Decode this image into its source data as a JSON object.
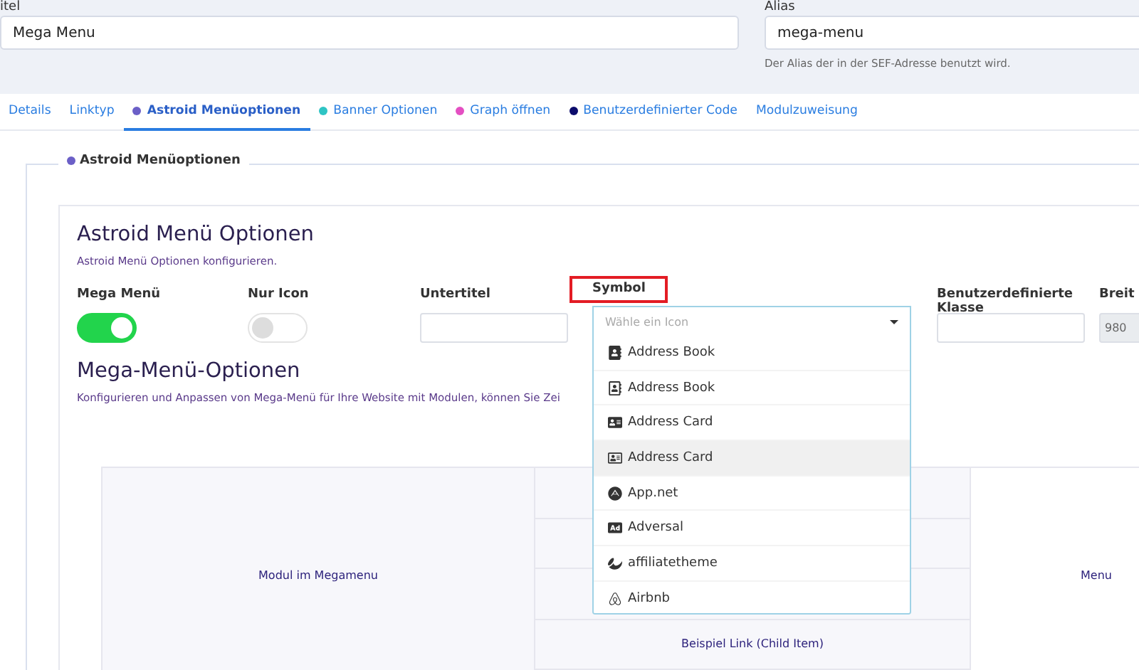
{
  "title_field": {
    "label": "itel",
    "value": "Mega Menu"
  },
  "alias_field": {
    "label": "Alias",
    "value": "mega-menu",
    "hint": "Der Alias der in der SEF-Adresse benutzt wird."
  },
  "tabs": [
    {
      "label": "Details",
      "selected": false
    },
    {
      "label": "Linktyp",
      "selected": false
    },
    {
      "label": "Astroid Menüoptionen",
      "selected": true,
      "color": "#6b5fc7"
    },
    {
      "label": "Banner Optionen",
      "selected": false,
      "color": "#2ec4c4"
    },
    {
      "label": "Graph öffnen",
      "selected": false,
      "color": "#e44fc2"
    },
    {
      "label": "Benutzerdefinierter Code",
      "selected": false,
      "color": "#0b0b6b"
    },
    {
      "label": "Modulzuweisung",
      "selected": false
    }
  ],
  "fieldset": {
    "legend": "Astroid Menüoptionen"
  },
  "section": {
    "heading": "Astroid Menü Optionen",
    "description": "Astroid Menü Optionen konfigurieren."
  },
  "fields": [
    {
      "kind": "toggle",
      "label": "Mega Menü",
      "on": true
    },
    {
      "kind": "toggle",
      "label": "Nur Icon",
      "on": false
    },
    {
      "kind": "text",
      "label": "Untertitel"
    },
    {
      "kind": "select",
      "label": "Symbol",
      "highlighted": true,
      "placeholder": "Wähle ein Icon",
      "expanded": true,
      "options": [
        {
          "label": "Address Book",
          "selected": false
        },
        {
          "label": "Address Book",
          "selected": false
        },
        {
          "label": "Address Card",
          "selected": false
        },
        {
          "label": "Address Card",
          "selected": true
        },
        {
          "label": "App.net",
          "selected": false
        },
        {
          "label": "Adversal",
          "selected": false
        },
        {
          "label": "affiliatetheme",
          "selected": false
        },
        {
          "label": "Airbnb",
          "selected": false
        }
      ]
    },
    {
      "kind": "text",
      "label": "Benutzerdefinierte Klasse"
    },
    {
      "kind": "disabled",
      "label": "Breit",
      "value": "980"
    }
  ],
  "mega_section": {
    "heading": "Mega-Menü-Optionen",
    "description": "Konfigurieren und Anpassen von Mega-Menü für Ihre Website mit Modulen, können Sie Zei"
  },
  "layout_table": {
    "left": "Modul im Megamenu",
    "middle_rows": [
      "",
      "",
      "",
      "Beispiel Link (Child Item)"
    ],
    "right": "Menu"
  }
}
